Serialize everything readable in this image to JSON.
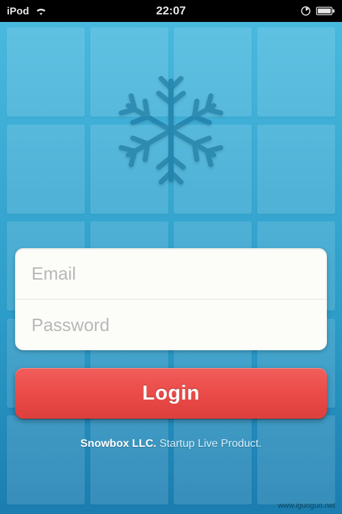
{
  "status_bar": {
    "device": "iPod",
    "time": "22:07"
  },
  "form": {
    "email_placeholder": "Email",
    "email_value": "",
    "password_placeholder": "Password",
    "password_value": "",
    "login_label": "Login"
  },
  "footer": {
    "company": "Snowbox LLC.",
    "tagline": "Startup Live Product."
  },
  "watermark": "www.iguoguo.net",
  "colors": {
    "accent_red": "#e84a47",
    "bg_top": "#4bbbe0",
    "bg_bottom": "#1b7db0"
  }
}
